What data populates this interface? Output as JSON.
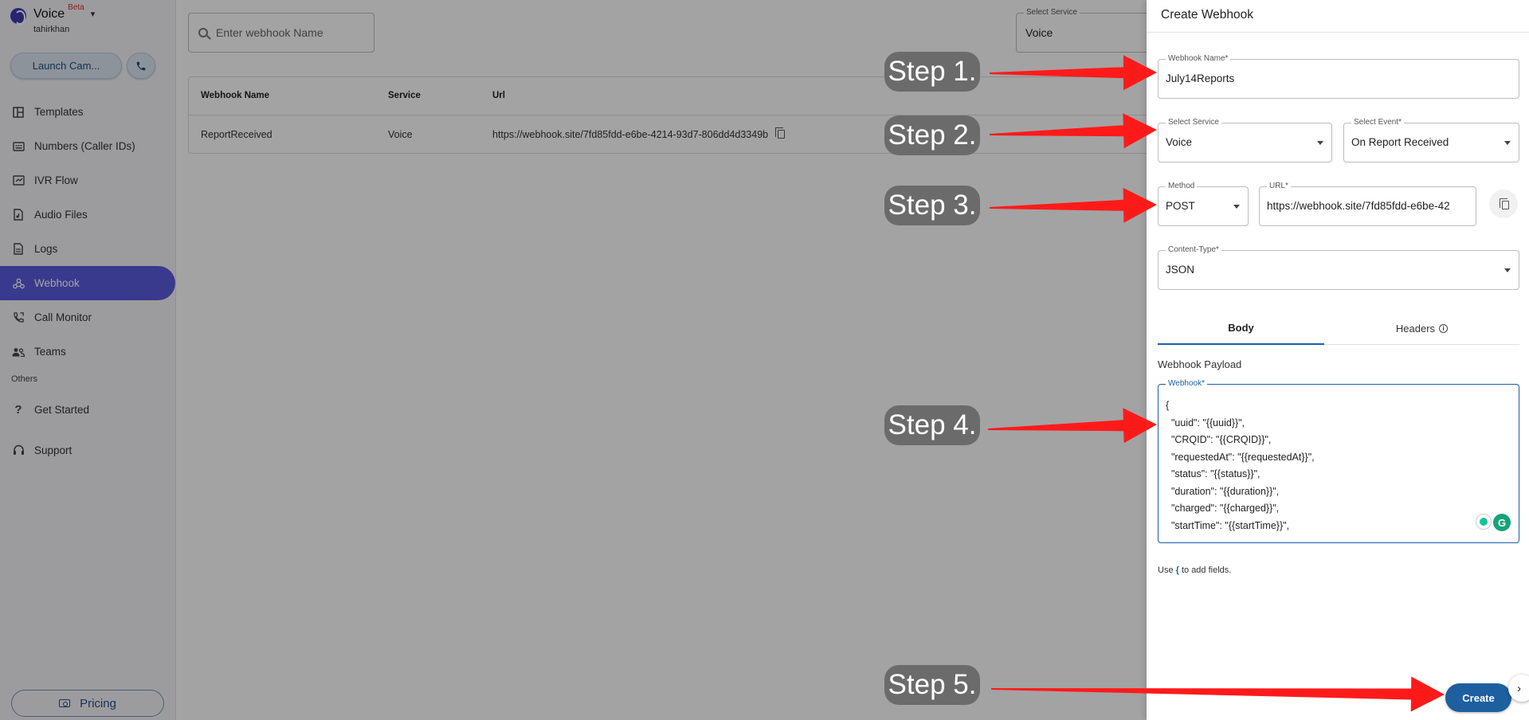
{
  "app": {
    "name": "Voice",
    "badge": "Beta",
    "user": "tahirkhan",
    "chevron": "▾"
  },
  "sidebar": {
    "launch_label": "Launch Cam...",
    "items": [
      {
        "label": "Templates",
        "icon": "template-icon"
      },
      {
        "label": "Numbers (Caller IDs)",
        "icon": "dialpad-icon"
      },
      {
        "label": "IVR Flow",
        "icon": "flow-icon"
      },
      {
        "label": "Audio Files",
        "icon": "audio-file-icon"
      },
      {
        "label": "Logs",
        "icon": "document-icon"
      },
      {
        "label": "Webhook",
        "icon": "webhook-icon",
        "active": true
      },
      {
        "label": "Call Monitor",
        "icon": "phone-monitor-icon"
      },
      {
        "label": "Teams",
        "icon": "team-icon"
      }
    ],
    "section_others": "Others",
    "others": [
      {
        "label": "Get Started",
        "icon": "question-icon"
      },
      {
        "label": "Support",
        "icon": "headset-icon"
      }
    ],
    "pricing_label": "Pricing"
  },
  "main": {
    "search_placeholder": "Enter webhook Name",
    "service_filter": {
      "label": "Select Service",
      "value": "Voice"
    },
    "table": {
      "headers": [
        "Webhook Name",
        "Service",
        "Url"
      ],
      "rows": [
        {
          "name": "ReportReceived",
          "service": "Voice",
          "url": "https://webhook.site/7fd85fdd-e6be-4214-93d7-806dd4d3349b"
        }
      ]
    }
  },
  "drawer": {
    "title": "Create Webhook",
    "webhook_name": {
      "label": "Webhook Name*",
      "value": "July14Reports"
    },
    "service": {
      "label": "Select Service",
      "value": "Voice"
    },
    "event": {
      "label": "Select Event*",
      "value": "On Report Received"
    },
    "method": {
      "label": "Method",
      "value": "POST"
    },
    "url": {
      "label": "URL*",
      "value": "https://webhook.site/7fd85fdd-e6be-42"
    },
    "content_type": {
      "label": "Content-Type*",
      "value": "JSON"
    },
    "tabs": {
      "body": "Body",
      "headers": "Headers"
    },
    "payload_title": "Webhook Payload",
    "payload": {
      "label": "Webhook*",
      "lines": [
        "{",
        "  \"uuid\": \"{{uuid}}\",",
        "  \"CRQID\": \"{{CRQID}}\",",
        "  \"requestedAt\": \"{{requestedAt}}\",",
        "  \"status\": \"{{status}}\",",
        "  \"duration\": \"{{duration}}\",",
        "  \"charged\": \"{{charged}}\",",
        "  \"startTime\": \"{{startTime}}\","
      ]
    },
    "hint": {
      "prefix": "Use ",
      "brace": "{",
      "suffix": " to add fields."
    },
    "create_label": "Create"
  },
  "annotations": {
    "steps": [
      "Step 1.",
      "Step 2.",
      "Step 3.",
      "Step 4.",
      "Step 5."
    ],
    "arrow_color": "#ff1a1a"
  },
  "colors": {
    "accent": "#5a5adf",
    "primary": "#1d5f9f",
    "overlay": "rgba(0,0,0,0.36)"
  }
}
